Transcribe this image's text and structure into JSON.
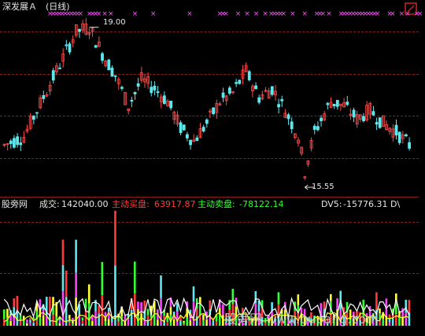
{
  "header": {
    "title": "深发展Ａ",
    "period": "(日线)"
  },
  "price_chart": {
    "high_label": "19.00",
    "low_label": "15.55",
    "high_index": 26,
    "low_index": 92,
    "price_min": 15.3,
    "price_max": 19.3,
    "x_markers_row": [
      0,
      1,
      2,
      3,
      4,
      5,
      6,
      7,
      8,
      9,
      10,
      13,
      14,
      15,
      16,
      18,
      20,
      28,
      34,
      46,
      56,
      57,
      58,
      62,
      65,
      68,
      71,
      73,
      74,
      75,
      76,
      77,
      80,
      84,
      88,
      89,
      90,
      92,
      96,
      97,
      98,
      99,
      100,
      101,
      102,
      103,
      104,
      105,
      106,
      107,
      108,
      112,
      113,
      116,
      118,
      121,
      122
    ]
  },
  "volume_panel": {
    "watermark_site": "股旁网",
    "volume_label": "成交:",
    "volume_value": "142040.00",
    "buy_label": "主动买盘:",
    "buy_value": "63917.87",
    "sell_label": "主动卖盘:",
    "sell_value": "-78122.14",
    "dv5_label": "DV5:",
    "dv5_value": "-15776.31",
    "dv_trunc": "D\\",
    "watermark_bottom": "股旁网 www.gupang.com"
  },
  "colors": {
    "up": "#ff4a4a",
    "down": "#5ee8ee",
    "grid": "#8a1d1d",
    "marker": "#ff55ff",
    "volume_line": "#ffffff",
    "dv_line": "#ffff33",
    "buy": "#ff3b3b",
    "sell": "#33ff33"
  },
  "icons": {
    "corner": "window-corner-icon",
    "arrow": "left-arrow-icon"
  }
}
